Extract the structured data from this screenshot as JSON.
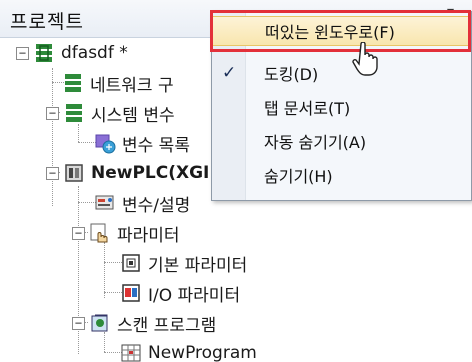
{
  "header": {
    "title": "프로젝트",
    "pin_glyph": "▾"
  },
  "tree": {
    "project": {
      "expander": "−",
      "icon": "project-network-icon",
      "label": "dfasdf *"
    },
    "network": {
      "icon": "network-icon",
      "label": "네트워크 구"
    },
    "system_vars": {
      "expander": "−",
      "icon": "system-variables-icon",
      "label": "시스템 변수"
    },
    "var_list": {
      "icon": "variable-list-icon",
      "label": "변수 목록"
    },
    "plc": {
      "expander": "−",
      "icon": "plc-icon",
      "label": "NewPLC(XGI"
    },
    "var_desc": {
      "icon": "variable-description-icon",
      "label": "변수/설명"
    },
    "parameters": {
      "expander": "−",
      "icon": "parameter-hand-icon",
      "label": "파라미터"
    },
    "basic_params": {
      "icon": "basic-parameter-icon",
      "label": "기본 파라미터"
    },
    "io_params": {
      "icon": "io-parameter-icon",
      "label": "I/O 파라미터"
    },
    "scan_program": {
      "expander": "−",
      "icon": "scan-program-icon",
      "label": "스캔 프로그램"
    },
    "new_program": {
      "icon": "program-icon",
      "label": "NewProgram"
    }
  },
  "context_menu": {
    "items": [
      {
        "label": "떠있는 윈도우로(F)",
        "checked": false,
        "hovered": true
      },
      {
        "label": "도킹(D)",
        "checked": true,
        "hovered": false
      },
      {
        "label": "탭 문서로(T)",
        "checked": false,
        "hovered": false
      },
      {
        "label": "자동 숨기기(A)",
        "checked": false,
        "hovered": false
      },
      {
        "label": "숨기기(H)",
        "checked": false,
        "hovered": false
      }
    ],
    "check_glyph": "✓"
  },
  "colors": {
    "highlight_border": "#e3303a",
    "hover_fill": "#f8e6ae",
    "menu_background": "#f4f7fb"
  }
}
